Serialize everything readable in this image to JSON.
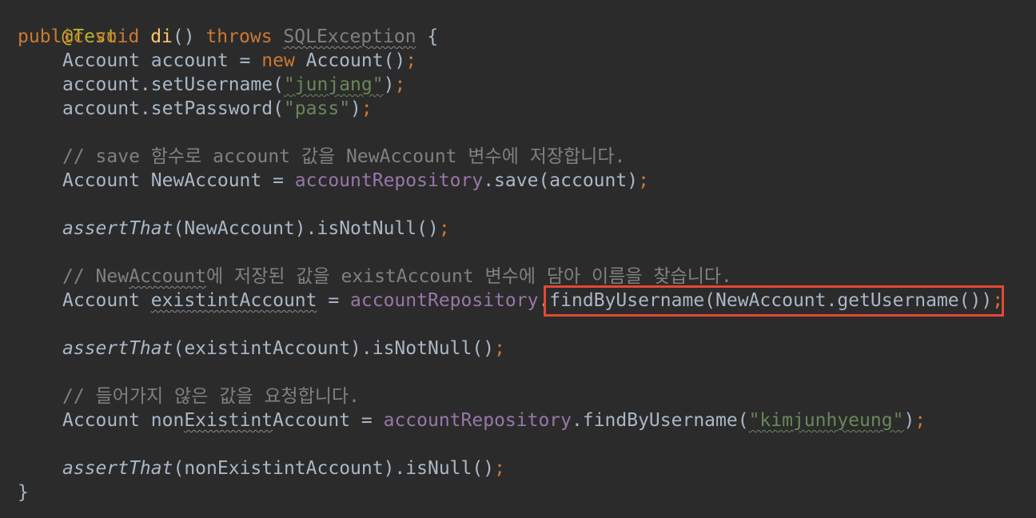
{
  "code": {
    "l1": {
      "annotation": "@Test"
    },
    "l2": {
      "kw_public": "public",
      "kw_void": "void",
      "method": "di",
      "paren": "() ",
      "kw_throws": "throws",
      "exception": "SQLException",
      "brace": " {"
    },
    "l3": {
      "type": "Account account = ",
      "kw_new": "new",
      "ctor": " Account()",
      "semi": ";"
    },
    "l4": {
      "call": "account.setUsername(",
      "str": "\"junjang\"",
      "close": ")",
      "semi": ";"
    },
    "l5": {
      "call": "account.setPassword(",
      "str": "\"pass\"",
      "close": ")",
      "semi": ";"
    },
    "l6": {
      "comment": "// save 함수로 account 값을 NewAccount 변수에 저장합니다."
    },
    "l7": {
      "decl": "Account NewAccount = ",
      "field": "accountRepository",
      "call": ".save(account)",
      "semi": ";"
    },
    "l8": {
      "fn": "assertThat",
      "rest": "(NewAccount).isNotNull()",
      "semi": ";"
    },
    "l9": {
      "c1": "// New",
      "c2": "Account",
      "c3": "에 저장된 값을 existAccount 변수에 담아 이름을 찾습니다."
    },
    "l10": {
      "decl": "Account ",
      "var": "existintAccount",
      "eq": " = ",
      "field": "accountRepository",
      "call": ".findByUsername(NewAccount.getUsername())",
      "semi": ";"
    },
    "l11": {
      "fn": "assertThat",
      "rest": "(existintAccount).isNotNull()",
      "semi": ";"
    },
    "l12": {
      "comment": "// 들어가지 않은 값을 요청합니다."
    },
    "l13": {
      "d1": "Account non",
      "d2": "Existint",
      "d3": "Account = ",
      "field": "accountRepository",
      "call": ".findByUsername(",
      "str": "\"kimjunhyeung\"",
      "close": ")",
      "semi": ";"
    },
    "l14": {
      "fn": "assertThat",
      "rest": "(nonExistintAccount).isNull()",
      "semi": ";"
    },
    "l15": {
      "brace": "}"
    }
  },
  "highlight_color": "#e24a33"
}
